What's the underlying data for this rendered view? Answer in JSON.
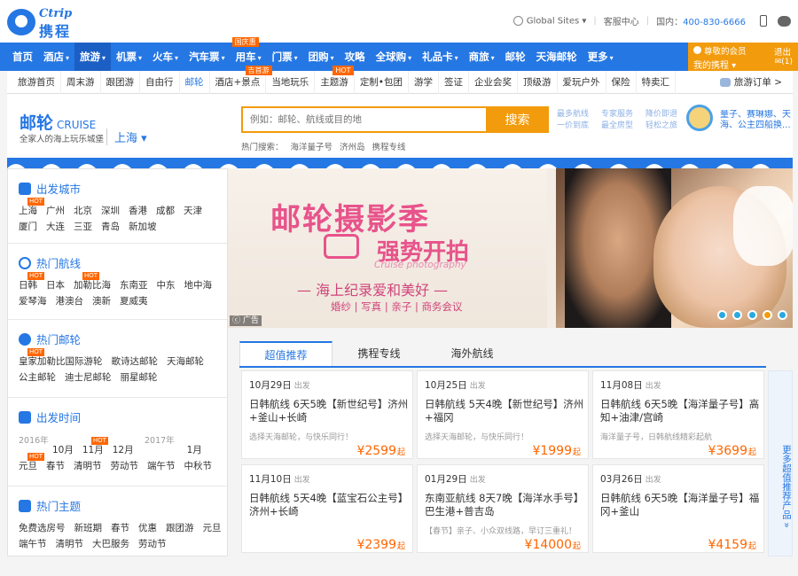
{
  "header": {
    "logo_en": "Ctrip",
    "logo_cn": "携程",
    "global_sites": "Global Sites",
    "service_center": "客服中心",
    "domestic": "国内：",
    "phone": "400-830-6666"
  },
  "nav": {
    "items": [
      {
        "label": "首页",
        "dropdown": false
      },
      {
        "label": "酒店",
        "dropdown": true
      },
      {
        "label": "旅游",
        "dropdown": true
      },
      {
        "label": "机票",
        "dropdown": true
      },
      {
        "label": "火车",
        "dropdown": true
      },
      {
        "label": "汽车票",
        "dropdown": true
      },
      {
        "label": "用车",
        "dropdown": true,
        "badge": "国庆惠"
      },
      {
        "label": "门票",
        "dropdown": true
      },
      {
        "label": "团购",
        "dropdown": true
      },
      {
        "label": "攻略",
        "dropdown": false
      },
      {
        "label": "全球购",
        "dropdown": true
      },
      {
        "label": "礼品卡",
        "dropdown": true
      },
      {
        "label": "商旅",
        "dropdown": true
      },
      {
        "label": "邮轮",
        "dropdown": false
      },
      {
        "label": "天海邮轮",
        "dropdown": false
      },
      {
        "label": "更多",
        "dropdown": true
      }
    ],
    "active_index": 2,
    "caret": "▾"
  },
  "member": {
    "greeting": "尊敬的会员",
    "my_ctrip": "我的携程",
    "logout": "退出",
    "messages": "(1)"
  },
  "subnav": {
    "items": [
      {
        "label": "旅游首页"
      },
      {
        "label": "周末游"
      },
      {
        "label": "跟团游"
      },
      {
        "label": "自由行"
      },
      {
        "label": "邮轮"
      },
      {
        "label": "酒店+景点",
        "badge": "吉首游"
      },
      {
        "label": "当地玩乐"
      },
      {
        "label": "主题游",
        "badge": "HOT"
      },
      {
        "label": "定制•包团"
      },
      {
        "label": "游学"
      },
      {
        "label": "签证"
      },
      {
        "label": "企业会奖"
      },
      {
        "label": "顶级游"
      },
      {
        "label": "爱玩户外"
      },
      {
        "label": "保险"
      },
      {
        "label": "特卖汇"
      }
    ],
    "active_index": 4,
    "orders": "旅游订单 >"
  },
  "hero": {
    "title": "邮轮",
    "title_en": "CRUISE",
    "slogan": "全家人的海上玩乐城堡",
    "city": "上海",
    "search_placeholder": "例如：邮轮、航线或目的地",
    "search_button": "搜索",
    "hot_search_label": "热门搜索：",
    "hot_search": [
      "海洋量子号",
      "济州岛",
      "携程专线"
    ],
    "features": [
      "最多航线",
      "一价到底",
      "专家服务",
      "最全房型",
      "降价即退",
      "轻松之旅"
    ],
    "promo_line1": "量子、赛琳娜、天",
    "promo_line2": "海、公主四船换..."
  },
  "sidebar": {
    "sections": [
      {
        "title": "出发城市",
        "icon": "location-icon",
        "links": [
          "上海",
          "广州",
          "北京",
          "深圳",
          "香港",
          "成都",
          "天津",
          "厦门",
          "大连",
          "三亚",
          "青岛",
          "新加坡"
        ],
        "hot": [
          0
        ]
      },
      {
        "title": "热门航线",
        "icon": "compass-icon",
        "links": [
          "日韩",
          "日本",
          "加勒比海",
          "东南亚",
          "中东",
          "地中海",
          "爱琴海",
          "港澳台",
          "澳新",
          "夏威夷"
        ],
        "hot": [
          0,
          2
        ]
      },
      {
        "title": "热门邮轮",
        "icon": "ship-wheel-icon",
        "links": [
          "皇家加勒比国际游轮",
          "歌诗达邮轮",
          "天海邮轮",
          "公主邮轮",
          "迪士尼邮轮",
          "丽星邮轮"
        ],
        "hot": [
          0
        ]
      },
      {
        "title": "出发时间",
        "icon": "calendar-icon",
        "year1": "2016年",
        "year2": "2017年",
        "links": [
          "10月",
          "11月",
          "12月",
          "1月",
          "元旦",
          "春节",
          "清明节",
          "劳动节",
          "端午节",
          "中秋节"
        ],
        "hot": [
          1,
          4
        ]
      },
      {
        "title": "热门主题",
        "icon": "lighthouse-icon",
        "links": [
          "免费选房号",
          "新班期",
          "春节",
          "优惠",
          "跟团游",
          "元旦",
          "端午节",
          "清明节",
          "大巴服务",
          "劳动节"
        ],
        "hot": []
      }
    ],
    "hot_label": "HOT"
  },
  "banner": {
    "title": "邮轮摄影季",
    "title2": "强势开拍",
    "title_en": "Cruise photography",
    "subtitle": "— 海上纪录爱和美好 —",
    "subtitle2": "婚纱 | 写真 | 亲子 | 商务会议",
    "ad_label": "广告",
    "active_dot": 3,
    "dot_count": 5
  },
  "tabs": {
    "items": [
      "超值推荐",
      "携程专线",
      "海外航线"
    ],
    "active_index": 0
  },
  "cards": [
    {
      "date": "10月29日",
      "depart": "出发",
      "title": "日韩航线 6天5晚【新世纪号】济州+釜山+长崎",
      "desc": "选择天海邮轮，与快乐同行！",
      "price": "¥2599",
      "unit": "起"
    },
    {
      "date": "10月25日",
      "depart": "出发",
      "title": "日韩航线 5天4晚【新世纪号】济州+福冈",
      "desc": "选择天海邮轮，与快乐同行！",
      "price": "¥1999",
      "unit": "起"
    },
    {
      "date": "11月08日",
      "depart": "出发",
      "title": "日韩航线 6天5晚【海洋量子号】高知+油津/宫崎",
      "desc": "海洋量子号，日韩航线精彩起航",
      "price": "¥3699",
      "unit": "起"
    },
    {
      "date": "11月10日",
      "depart": "出发",
      "title": "日韩航线 5天4晚【蓝宝石公主号】济州+长崎",
      "desc": "",
      "price": "¥2399",
      "unit": "起"
    },
    {
      "date": "01月29日",
      "depart": "出发",
      "title": "东南亚航线 8天7晚【海洋水手号】巴生港+普吉岛",
      "desc": "【春节】亲子、小众双线路，早订三重礼！",
      "price": "¥14000",
      "unit": "起"
    },
    {
      "date": "03月26日",
      "depart": "出发",
      "title": "日韩航线 6天5晚【海洋量子号】福冈+釜山",
      "desc": "",
      "price": "¥4159",
      "unit": "起"
    }
  ],
  "more_products": "更多超值推荐产品 »"
}
